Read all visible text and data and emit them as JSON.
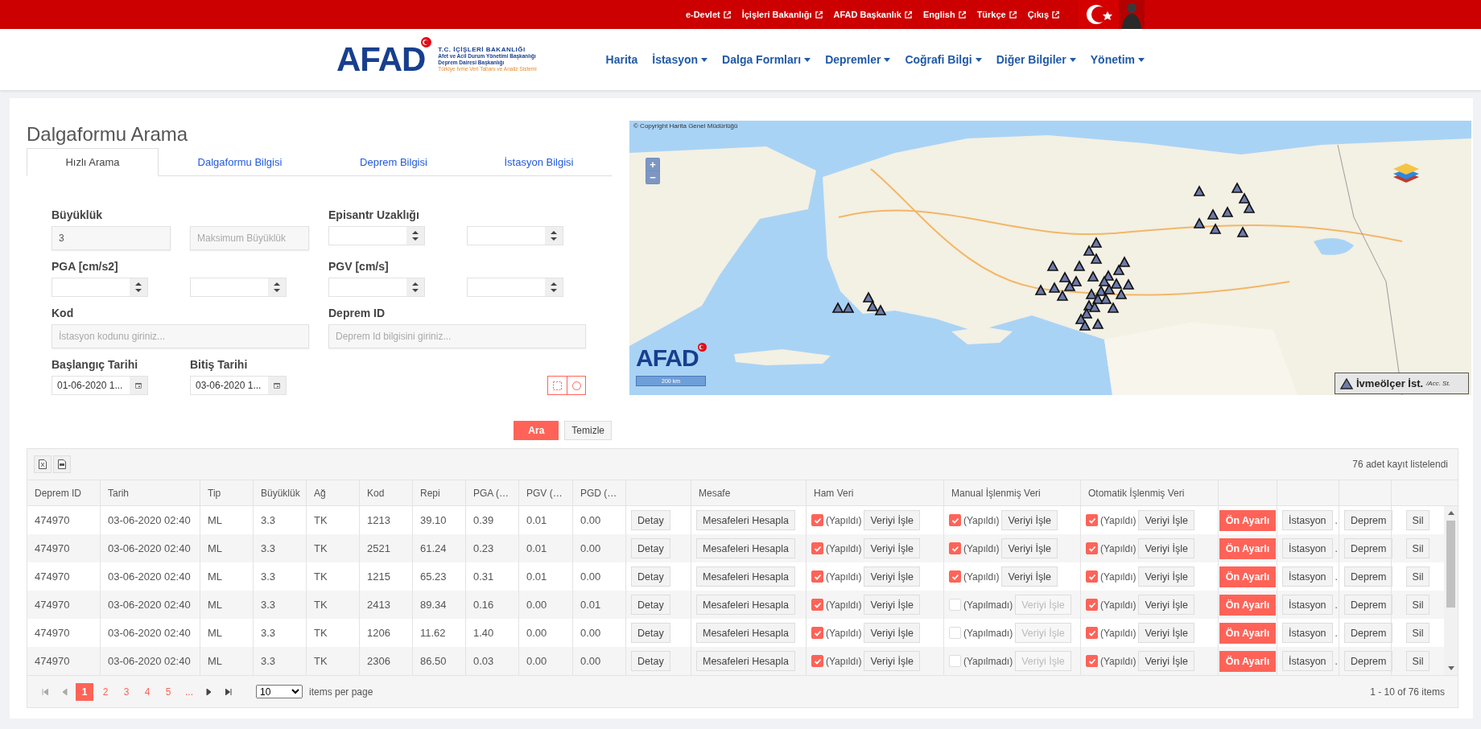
{
  "top_bar": {
    "links": [
      {
        "label": "e-Devlet"
      },
      {
        "label": "İçişleri Bakanlığı"
      },
      {
        "label": "AFAD Başkanlık"
      },
      {
        "label": "English"
      },
      {
        "label": "Türkçe"
      },
      {
        "label": "Çıkış"
      }
    ]
  },
  "header": {
    "logo": {
      "mark": "AFAD",
      "lines": [
        "T.C. İÇİŞLERİ BAKANLIĞI",
        "Afet ve Acil Durum Yönetimi Başkanlığı",
        "Deprem Dairesi Başkanlığı",
        "Türkiye İvme Veri Tabanı ve Analiz Sistemi"
      ]
    },
    "nav": [
      {
        "label": "Harita",
        "dropdown": false
      },
      {
        "label": "İstasyon",
        "dropdown": true
      },
      {
        "label": "Dalga Formları",
        "dropdown": true
      },
      {
        "label": "Depremler",
        "dropdown": true
      },
      {
        "label": "Coğrafi Bilgi",
        "dropdown": true
      },
      {
        "label": "Diğer Bilgiler",
        "dropdown": true
      },
      {
        "label": "Yönetim",
        "dropdown": true
      }
    ]
  },
  "search": {
    "title": "Dalgaformu Arama",
    "tabs": [
      {
        "label": "Hızlı Arama",
        "selected": true
      },
      {
        "label": "Dalgaformu Bilgisi",
        "selected": false
      },
      {
        "label": "Deprem Bilgisi",
        "selected": false
      },
      {
        "label": "İstasyon Bilgisi",
        "selected": false
      }
    ],
    "groups": [
      {
        "label": "Büyüklük",
        "inputs": [
          {
            "kind": "text",
            "value": "3"
          },
          {
            "kind": "text",
            "placeholder": "Maksimum Büyüklük"
          }
        ]
      },
      {
        "label": "Episantr Uzaklığı",
        "inputs": [
          {
            "kind": "spinner"
          },
          {
            "kind": "spinner"
          }
        ]
      },
      {
        "label": "PGA [cm/s2]",
        "inputs": [
          {
            "kind": "spinner"
          },
          {
            "kind": "spinner"
          }
        ]
      },
      {
        "label": "PGV [cm/s]",
        "inputs": [
          {
            "kind": "spinner"
          },
          {
            "kind": "spinner"
          }
        ]
      },
      {
        "label": "Kod",
        "inputs": [
          {
            "kind": "wide",
            "placeholder": "İstasyon kodunu giriniz..."
          }
        ]
      },
      {
        "label": "Deprem ID",
        "inputs": [
          {
            "kind": "wide",
            "placeholder": "Deprem Id bilgisini giriniz..."
          }
        ]
      },
      {
        "label": "Başlangıç Tarihi",
        "inputs": [
          {
            "kind": "date",
            "value": "01-06-2020 1..."
          }
        ]
      },
      {
        "label": "Bitiş Tarihi",
        "inputs": [
          {
            "kind": "date",
            "value": "03-06-2020 1..."
          }
        ]
      }
    ],
    "draw_tools": [
      {
        "kind": "rectangle"
      },
      {
        "kind": "circle"
      }
    ],
    "buttons": [
      {
        "label": "Ara",
        "kind": "primary"
      },
      {
        "label": "Temizle",
        "kind": "default"
      }
    ]
  },
  "map": {
    "copyright": "© Copyright Harita Genel Müdürlüğü",
    "zoom": [
      "+",
      "−"
    ],
    "logo": "AFAD",
    "scale": "200 km",
    "legend": {
      "label": "İvmeölçer İst.",
      "sublabel": "/Acc. St."
    }
  },
  "table": {
    "export_buttons": [
      {
        "kind": "excel"
      },
      {
        "kind": "pdf"
      }
    ],
    "record_count": "76 adet kayıt listelendi",
    "columns": [
      {
        "kind": "text",
        "label": "Deprem ID"
      },
      {
        "kind": "text",
        "label": "Tarih"
      },
      {
        "kind": "text",
        "label": "Tip"
      },
      {
        "kind": "text",
        "label": "Büyüklük"
      },
      {
        "kind": "text",
        "label": "Ağ"
      },
      {
        "kind": "text",
        "label": "Kod"
      },
      {
        "kind": "text",
        "label": "Repi"
      },
      {
        "kind": "text",
        "label": "PGA (…"
      },
      {
        "kind": "text",
        "label": "PGV (…"
      },
      {
        "kind": "text",
        "label": "PGD (…"
      },
      {
        "kind": "blank"
      },
      {
        "kind": "text",
        "label": "Mesafe"
      },
      {
        "kind": "text",
        "label": "Ham Veri"
      },
      {
        "kind": "text",
        "label": "Manual İşlenmiş Veri"
      },
      {
        "kind": "text",
        "label": "Otomatik İşlenmiş Veri"
      },
      {
        "kind": "blank"
      },
      {
        "kind": "blank"
      },
      {
        "kind": "blank"
      },
      {
        "kind": "blank"
      }
    ],
    "rows": [
      {
        "cells": [
          "474970",
          "03-06-2020 02:40",
          "ML",
          "3.3",
          "TK",
          "1213",
          "39.10",
          "0.39",
          "0.01",
          "0.00"
        ],
        "detay": "Detay",
        "mesafe": "Mesafeleri Hesapla",
        "processing": [
          {
            "checked": true,
            "status": "(Yapıldı)",
            "button": "Veriyi İşle",
            "disabled": false
          },
          {
            "checked": true,
            "status": "(Yapıldı)",
            "button": "Veriyi İşle",
            "disabled": false
          },
          {
            "checked": true,
            "status": "(Yapıldı)",
            "button": "Veriyi İşle",
            "disabled": false
          }
        ],
        "preset": "Ön Ayarlı",
        "istasyon": "İstasyon",
        "istasyon_note": ".",
        "deprem": "Deprem",
        "sil": "Sil"
      },
      {
        "cells": [
          "474970",
          "03-06-2020 02:40",
          "ML",
          "3.3",
          "TK",
          "2521",
          "61.24",
          "0.23",
          "0.01",
          "0.00"
        ],
        "detay": "Detay",
        "mesafe": "Mesafeleri Hesapla",
        "processing": [
          {
            "checked": true,
            "status": "(Yapıldı)",
            "button": "Veriyi İşle",
            "disabled": false
          },
          {
            "checked": true,
            "status": "(Yapıldı)",
            "button": "Veriyi İşle",
            "disabled": false
          },
          {
            "checked": true,
            "status": "(Yapıldı)",
            "button": "Veriyi İşle",
            "disabled": false
          }
        ],
        "preset": "Ön Ayarlı",
        "istasyon": "İstasyon",
        "istasyon_note": ".",
        "deprem": "Deprem",
        "sil": "Sil"
      },
      {
        "cells": [
          "474970",
          "03-06-2020 02:40",
          "ML",
          "3.3",
          "TK",
          "1215",
          "65.23",
          "0.31",
          "0.01",
          "0.00"
        ],
        "detay": "Detay",
        "mesafe": "Mesafeleri Hesapla",
        "processing": [
          {
            "checked": true,
            "status": "(Yapıldı)",
            "button": "Veriyi İşle",
            "disabled": false
          },
          {
            "checked": true,
            "status": "(Yapıldı)",
            "button": "Veriyi İşle",
            "disabled": false
          },
          {
            "checked": true,
            "status": "(Yapıldı)",
            "button": "Veriyi İşle",
            "disabled": false
          }
        ],
        "preset": "Ön Ayarlı",
        "istasyon": "İstasyon",
        "istasyon_note": ".",
        "deprem": "Deprem",
        "sil": "Sil"
      },
      {
        "cells": [
          "474970",
          "03-06-2020 02:40",
          "ML",
          "3.3",
          "TK",
          "2413",
          "89.34",
          "0.16",
          "0.00",
          "0.01"
        ],
        "detay": "Detay",
        "mesafe": "Mesafeleri Hesapla",
        "processing": [
          {
            "checked": true,
            "status": "(Yapıldı)",
            "button": "Veriyi İşle",
            "disabled": false
          },
          {
            "checked": false,
            "status": "(Yapılmadı)",
            "button": "Veriyi İşle",
            "disabled": true
          },
          {
            "checked": true,
            "status": "(Yapıldı)",
            "button": "Veriyi İşle",
            "disabled": false
          }
        ],
        "preset": "Ön Ayarlı",
        "istasyon": "İstasyon",
        "istasyon_note": ".",
        "deprem": "Deprem",
        "sil": "Sil"
      },
      {
        "cells": [
          "474970",
          "03-06-2020 02:40",
          "ML",
          "3.3",
          "TK",
          "1206",
          "11.62",
          "1.40",
          "0.00",
          "0.00"
        ],
        "detay": "Detay",
        "mesafe": "Mesafeleri Hesapla",
        "processing": [
          {
            "checked": true,
            "status": "(Yapıldı)",
            "button": "Veriyi İşle",
            "disabled": false
          },
          {
            "checked": false,
            "status": "(Yapılmadı)",
            "button": "Veriyi İşle",
            "disabled": true
          },
          {
            "checked": true,
            "status": "(Yapıldı)",
            "button": "Veriyi İşle",
            "disabled": false
          }
        ],
        "preset": "Ön Ayarlı",
        "istasyon": "İstasyon",
        "istasyon_note": ".",
        "deprem": "Deprem",
        "sil": "Sil"
      },
      {
        "cells": [
          "474970",
          "03-06-2020 02:40",
          "ML",
          "3.3",
          "TK",
          "2306",
          "86.50",
          "0.03",
          "0.00",
          "0.00"
        ],
        "detay": "Detay",
        "mesafe": "Mesafeleri Hesapla",
        "processing": [
          {
            "checked": true,
            "status": "(Yapıldı)",
            "button": "Veriyi İşle",
            "disabled": false
          },
          {
            "checked": false,
            "status": "(Yapılmadı)",
            "button": "Veriyi İşle",
            "disabled": true
          },
          {
            "checked": true,
            "status": "(Yapıldı)",
            "button": "Veriyi İşle",
            "disabled": false
          }
        ],
        "preset": "Ön Ayarlı",
        "istasyon": "İstasyon",
        "istasyon_note": ".",
        "deprem": "Deprem",
        "sil": "Sil"
      }
    ],
    "pager": {
      "back": [
        {
          "kind": "first",
          "disabled": true
        },
        {
          "kind": "prev",
          "disabled": true
        }
      ],
      "pages": [
        {
          "label": "1",
          "selected": true
        },
        {
          "label": "2",
          "selected": false
        },
        {
          "label": "3",
          "selected": false
        },
        {
          "label": "4",
          "selected": false
        },
        {
          "label": "5",
          "selected": false
        },
        {
          "label": "...",
          "selected": false
        }
      ],
      "forward": [
        {
          "kind": "next",
          "disabled": false
        },
        {
          "kind": "last",
          "disabled": false
        }
      ],
      "page_size": "10",
      "page_size_label": "items per page",
      "summary": "1 - 10 of 76 items"
    }
  }
}
